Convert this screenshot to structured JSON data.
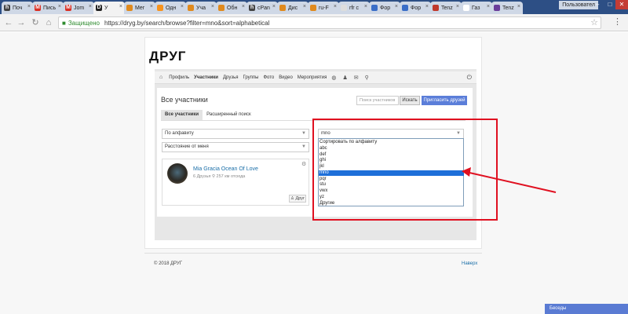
{
  "browser": {
    "tabs": [
      {
        "title": "Поч",
        "favicon": "h",
        "color": "#444444"
      },
      {
        "title": "Пись",
        "favicon": "M",
        "color": "#d93025"
      },
      {
        "title": "Jom",
        "favicon": "M",
        "color": "#d93025"
      },
      {
        "title": "У",
        "favicon": "D",
        "color": "#222222"
      },
      {
        "title": "Мег",
        "favicon": "",
        "color": "#e08a1e"
      },
      {
        "title": "Одн",
        "favicon": "",
        "color": "#f7931e"
      },
      {
        "title": "Уча",
        "favicon": "",
        "color": "#e08a1e"
      },
      {
        "title": "Обн",
        "favicon": "",
        "color": "#e08a1e"
      },
      {
        "title": "cPan",
        "favicon": "h",
        "color": "#444444"
      },
      {
        "title": "Дис",
        "favicon": "",
        "color": "#e08a1e"
      },
      {
        "title": "ru-F",
        "favicon": "",
        "color": "#e08a1e"
      },
      {
        "title": "rfr с",
        "favicon": "",
        "color": "#dddddd"
      },
      {
        "title": "Фор",
        "favicon": "",
        "color": "#3a6ec7"
      },
      {
        "title": "Фор",
        "favicon": "",
        "color": "#3a6ec7"
      },
      {
        "title": "Tenz",
        "favicon": "",
        "color": "#c0392b"
      },
      {
        "title": "Газ",
        "favicon": "",
        "color": "#ffffff"
      },
      {
        "title": "Tenz",
        "favicon": "",
        "color": "#6a3d9a"
      }
    ],
    "user_label": "Пользовател",
    "secure_text": "Защищено",
    "url": "https://dryg.by/search/browse?filter=mno&sort=alphabetical"
  },
  "site": {
    "title": "ДРУГ",
    "nav": [
      "Профиль",
      "Участники",
      "Друзья",
      "Группы",
      "Фото",
      "Видео",
      "Мероприятия"
    ],
    "active_nav": "Участники"
  },
  "members": {
    "heading": "Все участники",
    "search_placeholder": "Поиск участников",
    "search_button": "Искать",
    "invite_button": "Пригласить друзей",
    "tabs": [
      "Все участники",
      "Расширенный поиск"
    ],
    "sort_select": "По алфавиту",
    "distance_select": "Расстояние от меня",
    "filter_select": "mno",
    "filter_options": [
      "Сортировать по алфавиту",
      "abc",
      "def",
      "ghi",
      "jkl",
      "mno",
      "pqr",
      "stu",
      "vwx",
      "yz",
      "Другие"
    ],
    "selected_option": "mno",
    "card": {
      "name": "Mia Gracia Ocean Of Love",
      "friends": "6 Друзья",
      "distance": "257 км отсюда",
      "friend_button": "Друг"
    }
  },
  "footer": {
    "copyright": "© 2018 ДРУГ",
    "up_link": "Наверх"
  },
  "chat": {
    "label": "Беседы"
  },
  "colors": {
    "annotation_red": "#e01020",
    "accent_blue": "#5b7ed9",
    "selection_blue": "#1e6fd9"
  }
}
